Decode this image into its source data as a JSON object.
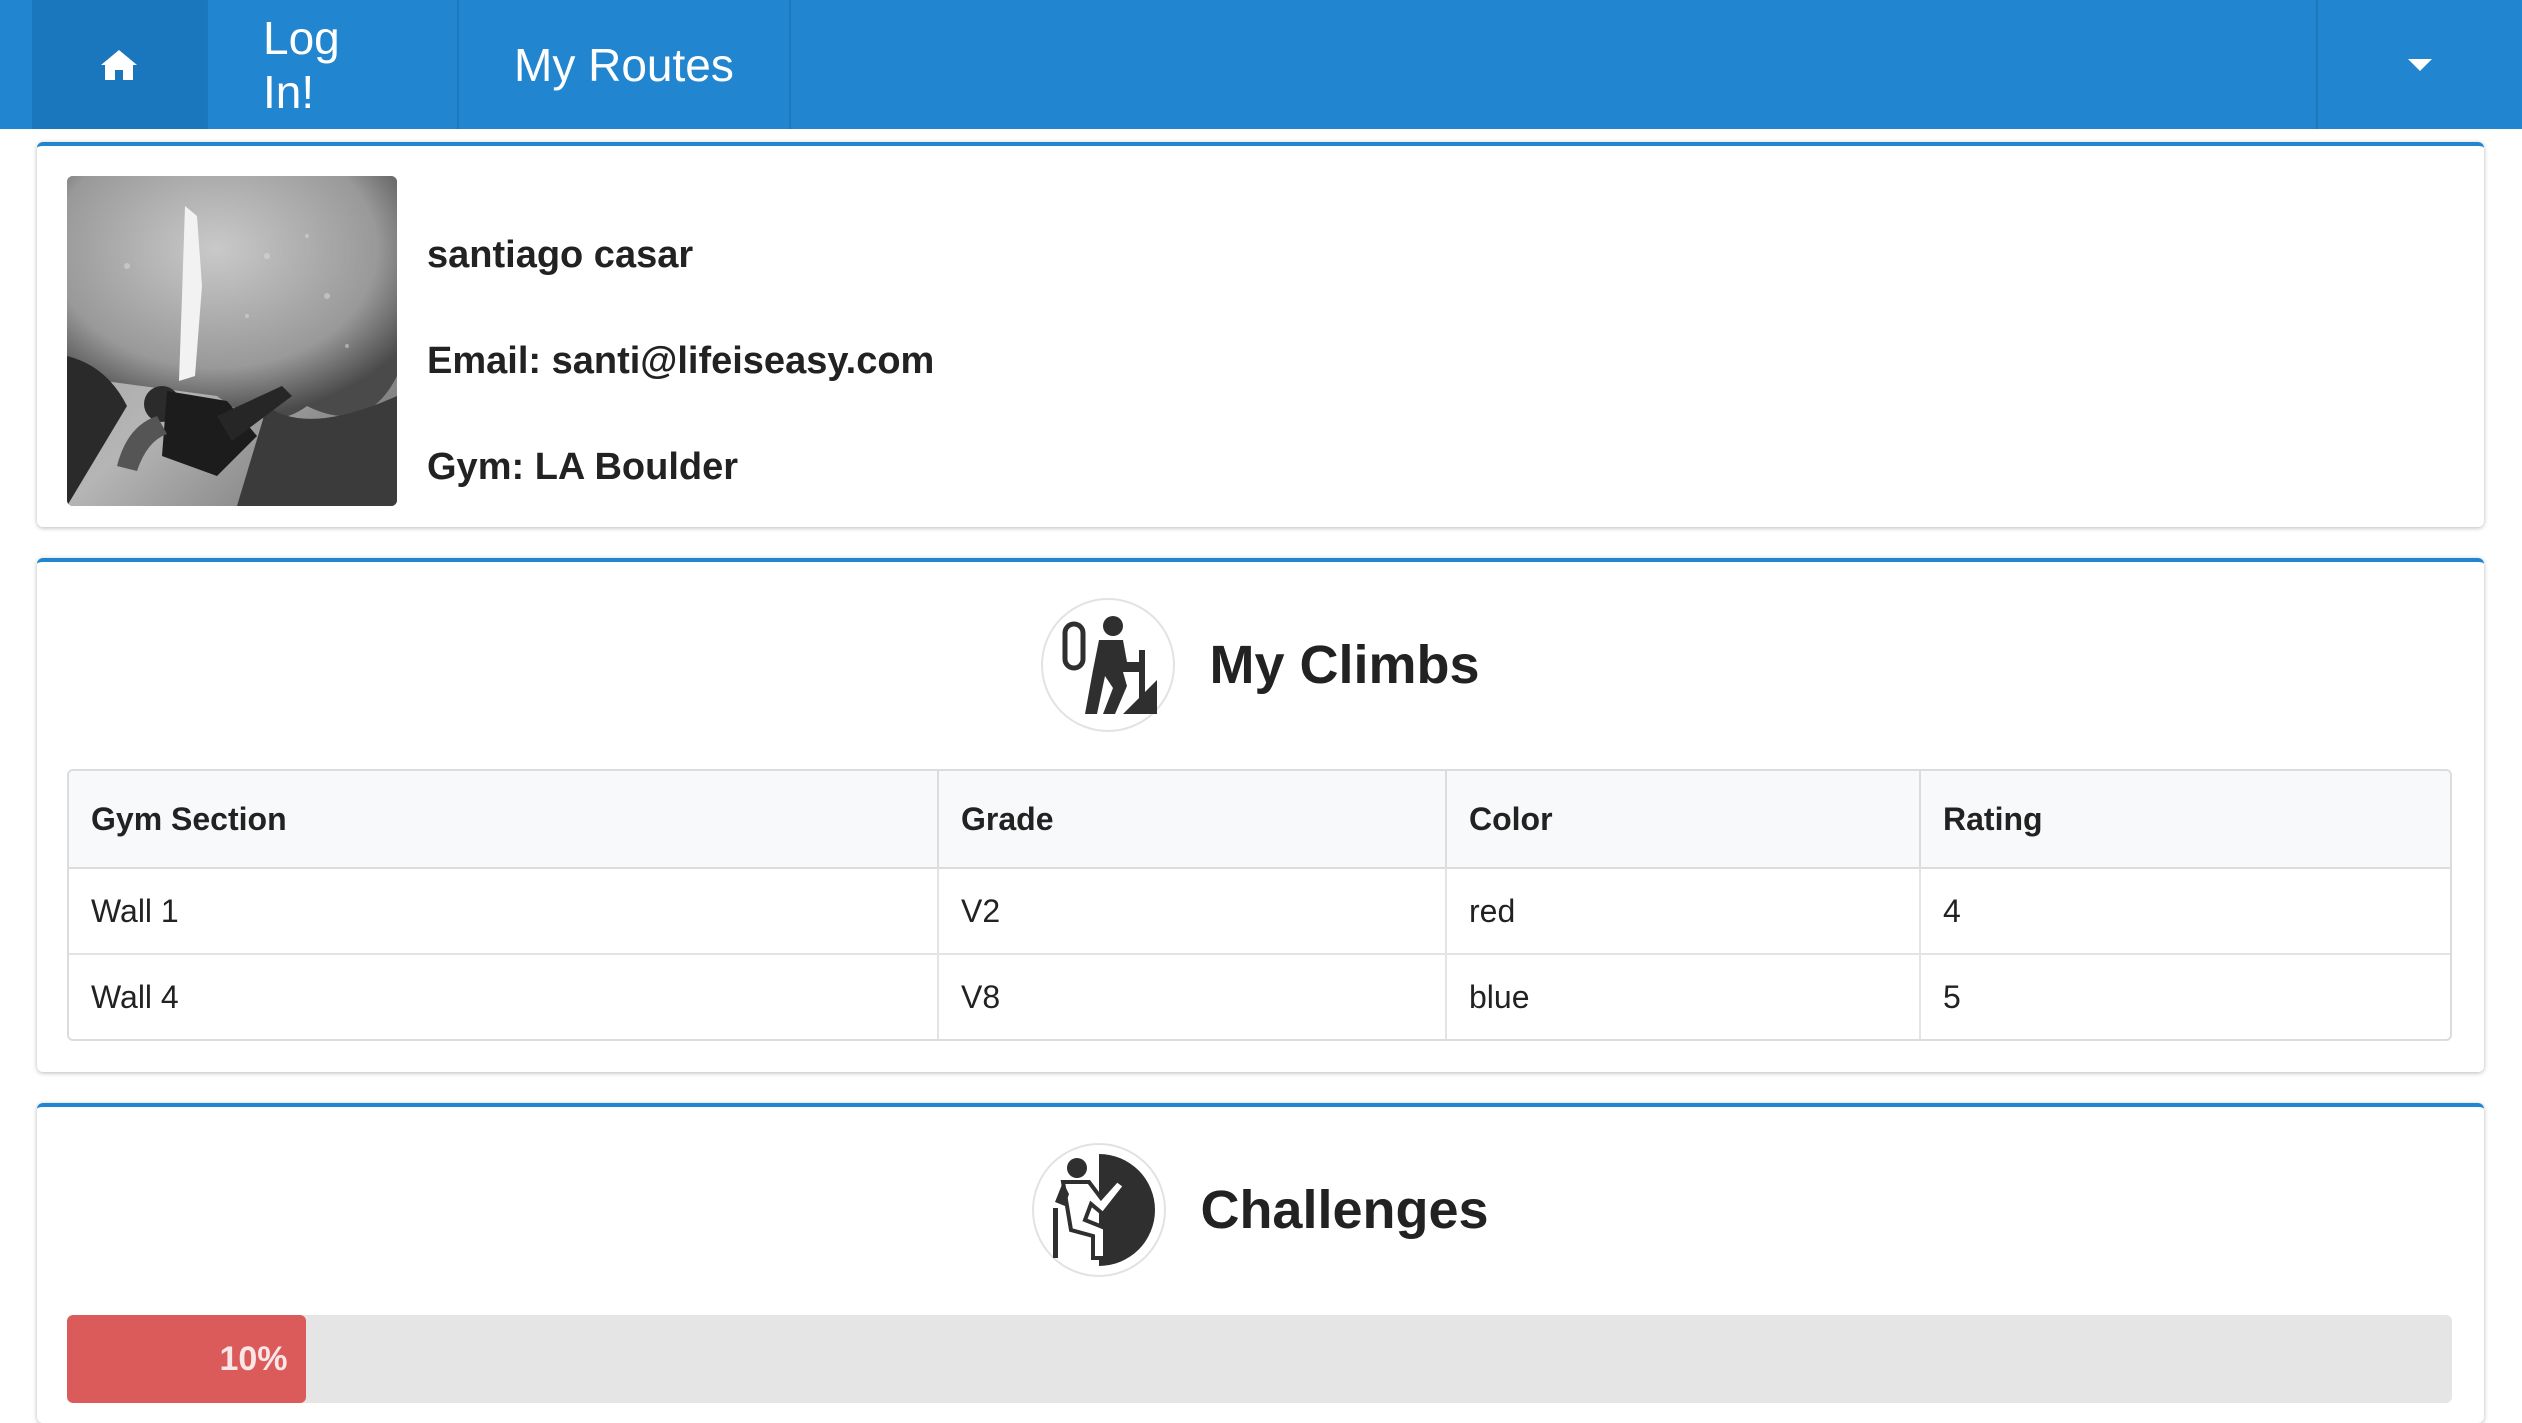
{
  "navbar": {
    "home_icon": "home-icon",
    "login_label": "Log In!",
    "routes_label": "My Routes",
    "dropdown_icon": "caret-down-icon",
    "color": "#2185d0"
  },
  "profile": {
    "name": "santiago casar",
    "email": "Email: santi@lifeiseasy.com",
    "gym": "Gym: LA Boulder",
    "avatar": "climber-photo"
  },
  "climbs": {
    "title": "My Climbs",
    "icon": "hiker-climber-icon",
    "columns": [
      "Gym Section",
      "Grade",
      "Color",
      "Rating"
    ],
    "rows": [
      [
        "Wall 1",
        "V2",
        "red",
        "4"
      ],
      [
        "Wall 4",
        "V8",
        "blue",
        "5"
      ]
    ]
  },
  "challenges": {
    "title": "Challenges",
    "icon": "rock-climber-icon",
    "progress_label": "10%",
    "progress_value": 0.1,
    "progress_color": "#db5b5b"
  }
}
